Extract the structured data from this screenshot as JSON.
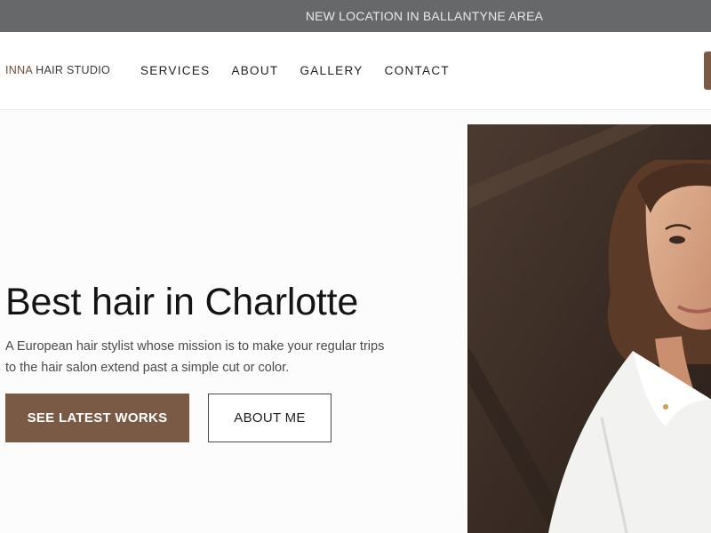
{
  "announcement": {
    "text": "NEW LOCATION IN BALLANTYNE AREA"
  },
  "brand": {
    "name_strong": "INNA",
    "name_rest": " HAIR STUDIO"
  },
  "nav": {
    "items": [
      {
        "label": "SERVICES"
      },
      {
        "label": "ABOUT"
      },
      {
        "label": "GALLERY"
      },
      {
        "label": "CONTACT"
      }
    ]
  },
  "hero": {
    "title": "Best hair in Charlotte",
    "subtitle": "A European hair stylist whose mission is to make your regular trips to the hair salon extend past a simple cut or color.",
    "primary_button": "SEE LATEST WORKS",
    "secondary_button": "ABOUT ME"
  },
  "colors": {
    "accent": "#7a5a45",
    "announcement_bg": "#67686a",
    "text": "#141414"
  }
}
